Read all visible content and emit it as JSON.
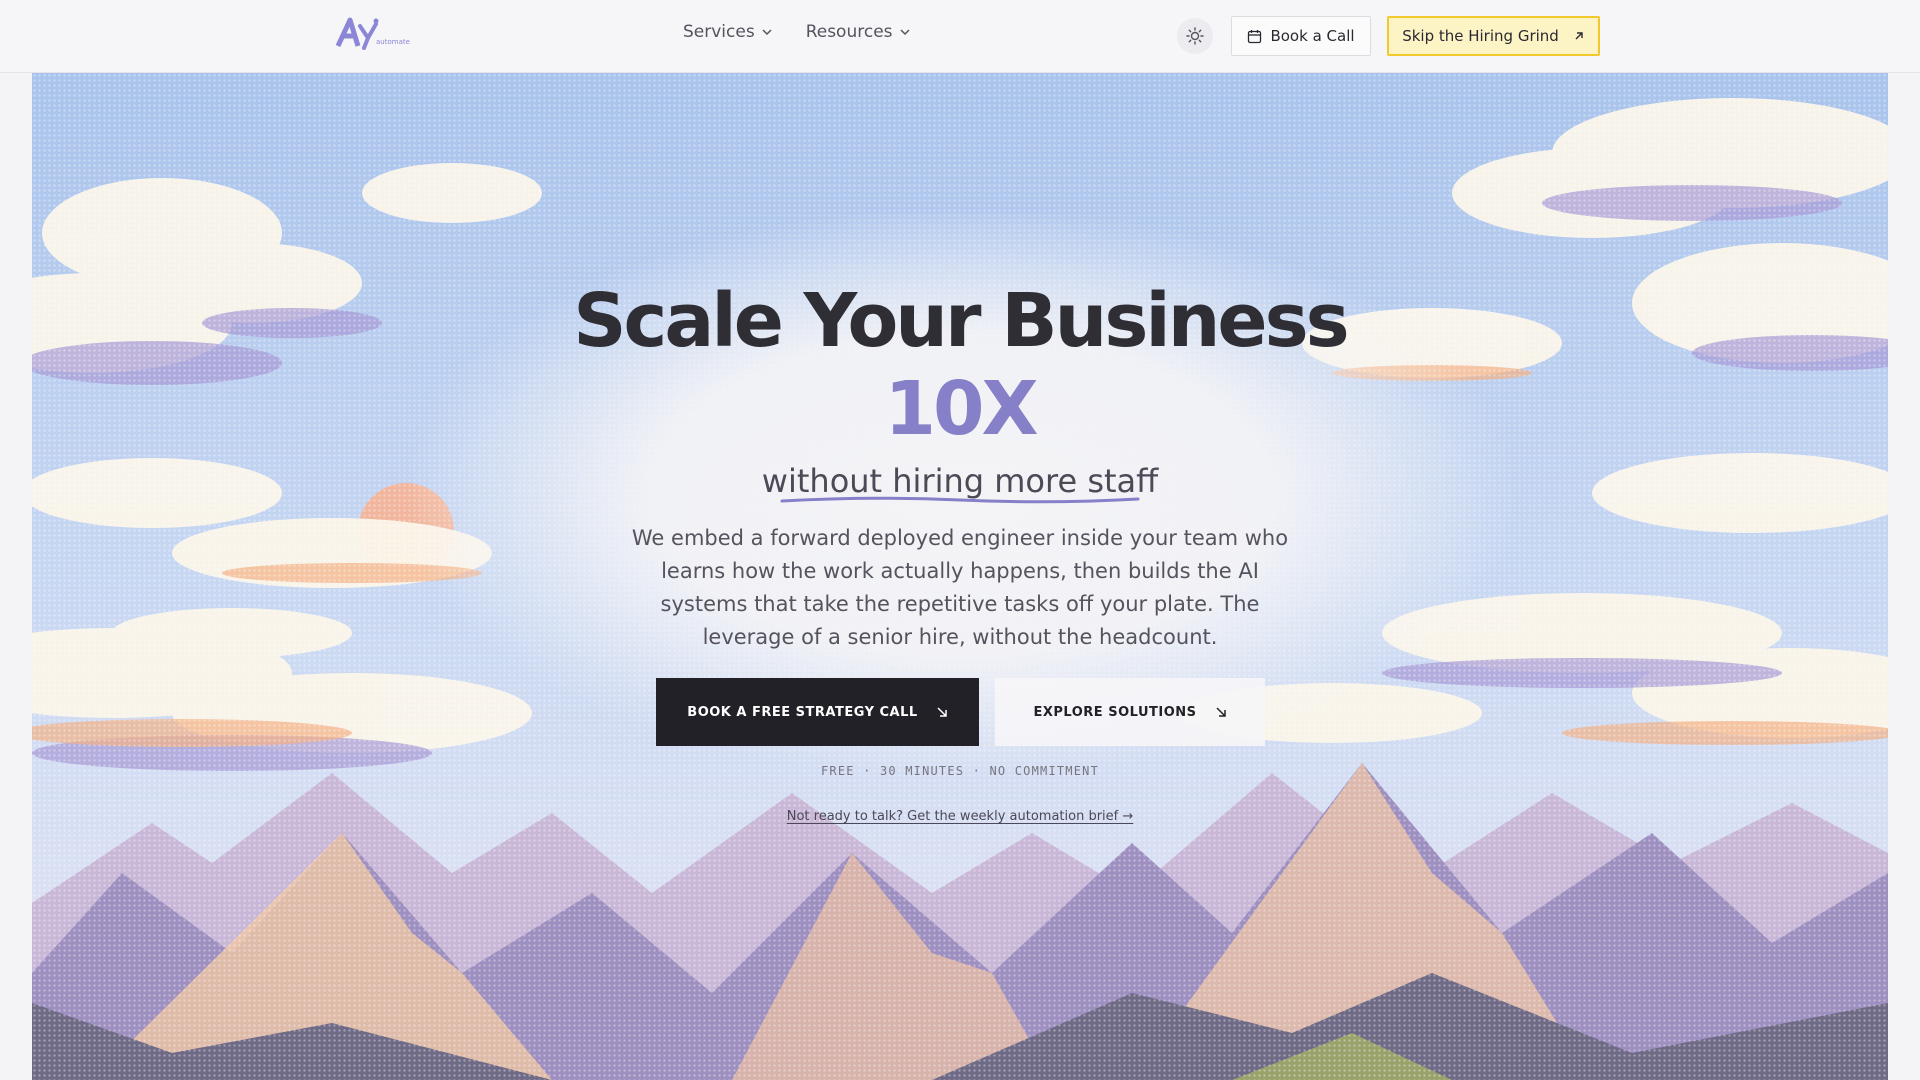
{
  "nav": {
    "logo_text": "Ay",
    "logo_sub": "automate",
    "menu": [
      {
        "label": "Services"
      },
      {
        "label": "Resources"
      }
    ],
    "book_call_label": "Book a Call",
    "skip_label": "Skip the Hiring Grind"
  },
  "hero": {
    "headline": "Scale Your Business",
    "accent": "10X",
    "subheadline": "without hiring more staff",
    "description": "We embed a forward deployed engineer inside your team who learns how the work actually happens, then builds the AI systems that take the repetitive tasks off your plate. The leverage of a senior hire, without the headcount.",
    "primary_cta": "BOOK A FREE STRATEGY CALL",
    "secondary_cta": "EXPLORE SOLUTIONS",
    "meta": "FREE · 30 MINUTES · NO COMMITMENT",
    "brief_link": "Not ready to talk? Get the weekly automation brief →"
  },
  "icons": {
    "theme": "sun-icon",
    "calendar": "calendar-icon",
    "external": "arrow-up-right-icon",
    "cta": "arrow-down-right-icon"
  },
  "colors": {
    "accent": "#8580c8",
    "dark": "#222127",
    "highlight": "#f1c92c",
    "background": "#f4f3f5"
  }
}
